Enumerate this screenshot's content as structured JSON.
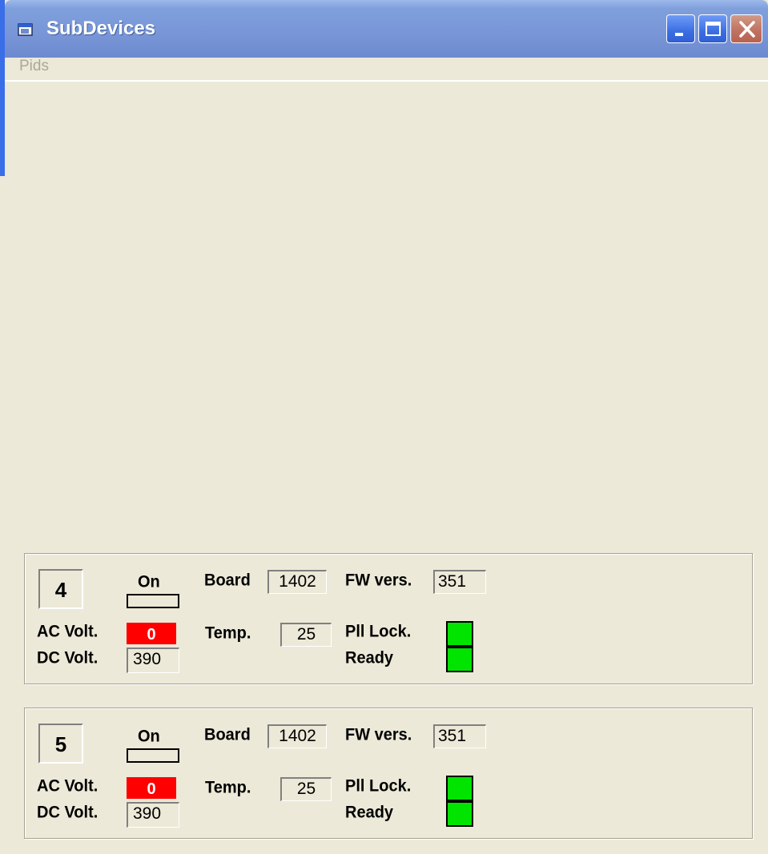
{
  "window": {
    "title": "SubDevices",
    "icon": "app-window-icon",
    "controls": [
      "minimize-button",
      "maximize-button",
      "close-button"
    ]
  },
  "menu": {
    "items": [
      "Pids"
    ]
  },
  "labels": {
    "on": "On",
    "board": "Board",
    "fw_vers": "FW vers.",
    "ac_volt": "AC Volt.",
    "dc_volt": "DC Volt.",
    "temp": "Temp.",
    "pll_lock": "Pll Lock.",
    "ready": "Ready"
  },
  "devices": [
    {
      "id": "4",
      "board": "1402",
      "fw_version": "351",
      "ac_volt": "0",
      "dc_volt": "390",
      "temp": "25",
      "pll_lock_color": "#00E400",
      "ready_color": "#00E400",
      "ac_volt_color": "#FF0000"
    },
    {
      "id": "5",
      "board": "1402",
      "fw_version": "351",
      "ac_volt": "0",
      "dc_volt": "390",
      "temp": "25",
      "pll_lock_color": "#00E400",
      "ready_color": "#00E400",
      "ac_volt_color": "#FF0000"
    }
  ]
}
